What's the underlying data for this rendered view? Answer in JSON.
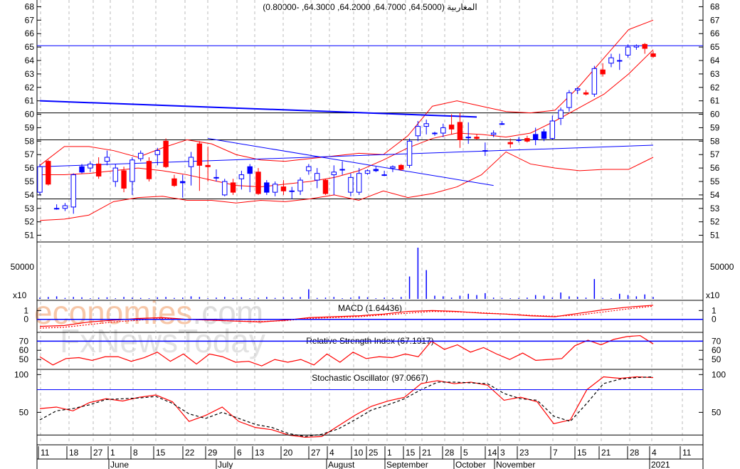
{
  "title": "المغاربية (64.5000, 64.7000, 64.2000, 64.3000, -0.80000)",
  "watermark": {
    "brand1": "economies",
    "brand2": ".com",
    "brand3": "FxNewsToday"
  },
  "colors": {
    "up": "#0000ff",
    "down": "#ff0000",
    "band": "#ff0000",
    "line": "#0000ff"
  },
  "chart_data": [
    {
      "type": "candlestick",
      "name": "price",
      "title": "المغاربية (64.5000, 64.7000, 64.2000, 64.3000, -0.80000)",
      "ylim": [
        50.5,
        68.5
      ],
      "yticks": [
        51,
        52,
        53,
        54,
        55,
        56,
        57,
        58,
        59,
        60,
        61,
        62,
        63,
        64,
        65,
        66,
        67,
        68
      ],
      "candles": [
        [
          54.2,
          56.3,
          54.0,
          56.1
        ],
        [
          56.5,
          56.6,
          54.7,
          54.8
        ],
        [
          53.0,
          53.3,
          52.9,
          53.0
        ],
        [
          53.0,
          53.4,
          52.8,
          53.2
        ],
        [
          53.1,
          55.6,
          52.6,
          55.5
        ],
        [
          56.1,
          56.3,
          55.6,
          55.7
        ],
        [
          56.0,
          56.5,
          55.7,
          56.3
        ],
        [
          56.3,
          56.8,
          55.2,
          55.4
        ],
        [
          56.5,
          57.3,
          56.2,
          56.8
        ],
        [
          55.0,
          56.3,
          54.6,
          56.0
        ],
        [
          55.8,
          56.1,
          54.2,
          54.5
        ],
        [
          55.0,
          56.8,
          54.0,
          56.6
        ],
        [
          56.7,
          57.3,
          56.5,
          57.1
        ],
        [
          56.5,
          56.8,
          55.0,
          55.2
        ],
        [
          57.0,
          57.5,
          56.2,
          57.3
        ],
        [
          58.0,
          58.2,
          56.0,
          56.1
        ],
        [
          55.2,
          55.5,
          54.6,
          54.7
        ],
        [
          55.0,
          55.5,
          53.8,
          54.9
        ],
        [
          56.1,
          57.2,
          54.7,
          56.8
        ],
        [
          57.8,
          58.0,
          54.3,
          56.2
        ],
        [
          56.2,
          57.6,
          55.0,
          56.1
        ],
        [
          55.3,
          55.9,
          55.0,
          55.3
        ],
        [
          54.0,
          55.2,
          53.9,
          55.0
        ],
        [
          54.9,
          55.2,
          54.0,
          54.2
        ],
        [
          55.2,
          55.8,
          54.4,
          55.5
        ],
        [
          56.1,
          56.3,
          54.2,
          55.6
        ],
        [
          55.7,
          56.0,
          54.0,
          54.1
        ],
        [
          54.9,
          55.1,
          54.0,
          54.2
        ],
        [
          54.2,
          55.0,
          53.9,
          54.8
        ],
        [
          54.6,
          55.1,
          54.0,
          54.3
        ],
        [
          54.3,
          54.6,
          53.7,
          54.3
        ],
        [
          54.3,
          55.3,
          54.0,
          55.1
        ],
        [
          55.8,
          56.3,
          55.5,
          56.1
        ],
        [
          55.1,
          56.0,
          54.5,
          55.6
        ],
        [
          55.1,
          55.2,
          54.0,
          54.1
        ],
        [
          55.5,
          56.2,
          54.0,
          55.7
        ],
        [
          55.9,
          56.5,
          55.5,
          55.9
        ],
        [
          54.2,
          55.6,
          53.9,
          55.3
        ],
        [
          54.2,
          56.0,
          54.0,
          55.6
        ],
        [
          55.6,
          55.9,
          55.5,
          55.8
        ],
        [
          55.9,
          56.1,
          55.7,
          55.8
        ],
        [
          55.5,
          55.8,
          55.4,
          55.5
        ],
        [
          56.0,
          56.2,
          55.7,
          56.1
        ],
        [
          56.2,
          56.3,
          55.8,
          55.9
        ],
        [
          56.2,
          58.2,
          56.0,
          58.0
        ],
        [
          58.4,
          59.5,
          58.0,
          59.1
        ],
        [
          59.1,
          59.6,
          58.5,
          59.3
        ],
        [
          58.6,
          58.7,
          58.4,
          58.6
        ],
        [
          58.6,
          59.3,
          58.3,
          59.0
        ],
        [
          59.2,
          60.0,
          58.5,
          58.9
        ],
        [
          59.4,
          60.1,
          57.5,
          58.1
        ],
        [
          58.3,
          59.4,
          57.8,
          58.3
        ],
        [
          58.3,
          58.5,
          58.1,
          58.2
        ],
        [
          57.3,
          57.9,
          56.9,
          57.3
        ],
        [
          58.5,
          58.8,
          58.3,
          58.6
        ],
        [
          59.3,
          59.5,
          59.2,
          59.3
        ],
        [
          57.9,
          58.2,
          57.5,
          57.8
        ],
        [
          58.1,
          58.3,
          57.9,
          58.1
        ],
        [
          58.2,
          58.4,
          57.9,
          58.0
        ],
        [
          58.5,
          59.0,
          57.7,
          58.1
        ],
        [
          58.7,
          58.9,
          58.0,
          58.2
        ],
        [
          58.2,
          59.9,
          58.1,
          59.5
        ],
        [
          59.7,
          60.5,
          59.2,
          60.3
        ],
        [
          60.5,
          61.8,
          60.2,
          61.6
        ],
        [
          61.8,
          62.0,
          61.5,
          61.9
        ],
        [
          61.6,
          61.8,
          61.4,
          61.5
        ],
        [
          61.5,
          63.6,
          61.3,
          63.4
        ],
        [
          63.3,
          63.8,
          62.8,
          63.0
        ],
        [
          63.8,
          64.5,
          63.5,
          64.2
        ],
        [
          64.0,
          64.5,
          63.3,
          64.0
        ],
        [
          64.4,
          65.2,
          64.2,
          65.0
        ],
        [
          65.0,
          65.2,
          64.8,
          65.1
        ],
        [
          65.2,
          65.3,
          64.5,
          64.9
        ],
        [
          64.5,
          64.7,
          64.2,
          64.3
        ]
      ],
      "bollinger_upper": [
        56.2,
        57.6,
        57.6,
        57.3,
        56.8,
        57.5,
        58.1,
        57.8,
        57.0,
        56.6,
        56.5,
        56.7,
        56.9,
        57.1,
        57.0,
        58.4,
        60.6,
        61.0,
        60.6,
        60.2,
        60.1,
        60.3,
        62.1,
        64.2,
        66.3,
        67.0
      ],
      "bollinger_middle": [
        55.5,
        55.5,
        55.6,
        55.8,
        56.0,
        55.8,
        55.5,
        55.1,
        54.7,
        54.6,
        54.8,
        55.0,
        55.3,
        55.8,
        56.6,
        57.5,
        58.2,
        58.6,
        58.5,
        58.3,
        58.6,
        59.5,
        60.5,
        61.5,
        63.0,
        64.8
      ],
      "bollinger_lower": [
        52.1,
        52.2,
        52.5,
        53.5,
        53.8,
        53.9,
        53.6,
        53.6,
        53.4,
        53.6,
        53.5,
        53.7,
        54.0,
        53.6,
        54.3,
        53.8,
        54.1,
        54.6,
        55.5,
        57.2,
        56.3,
        56.0,
        55.8,
        55.9,
        55.9,
        56.8
      ],
      "horizontal_lines": [
        65.1,
        60.1,
        58.1,
        53.7
      ],
      "trendlines": [
        [
          [
            0,
            61.0
          ],
          [
            52,
            59.8
          ]
        ],
        [
          [
            20,
            58.2
          ],
          [
            54,
            54.7
          ]
        ],
        [
          [
            0,
            56.1
          ],
          [
            73,
            57.7
          ]
        ]
      ]
    },
    {
      "type": "bar",
      "name": "volume",
      "ytick_label": "50000",
      "scale_label": "x10",
      "ylim": [
        0,
        80000
      ],
      "values": [
        2000,
        3000,
        4000,
        1500,
        3000,
        2500,
        1000,
        2000,
        2500,
        1000,
        3000,
        2000,
        1500,
        1000,
        2500,
        3000,
        1500,
        2000,
        4000,
        3000,
        1000,
        2000,
        3000,
        1500,
        2500,
        1000,
        2000,
        3000,
        1500,
        2500,
        2000,
        3000,
        15000,
        1500,
        2000,
        3000,
        1000,
        2000,
        4000,
        2500,
        1000,
        2000,
        1500,
        3000,
        35000,
        80000,
        45000,
        5000,
        4000,
        2000,
        5000,
        8000,
        6000,
        9000,
        2000,
        1500,
        1000,
        1500,
        2000,
        6000,
        5000,
        2000,
        10000,
        4000,
        3000,
        2000,
        31000,
        1500,
        1000,
        8000,
        6000,
        4000,
        7000,
        3000
      ]
    },
    {
      "type": "line",
      "name": "macd",
      "title": "MACD (1.64436)",
      "yticks": [
        1,
        0
      ],
      "ylim": [
        -1.4,
        2.0
      ],
      "macd": [
        -0.8,
        -0.7,
        -0.3,
        -0.1,
        0.1,
        0.2,
        0.0,
        -0.1,
        -0.2,
        -0.3,
        -0.1,
        0.2,
        0.3,
        0.4,
        0.6,
        0.9,
        1.0,
        0.9,
        0.7,
        0.6,
        0.4,
        0.3,
        0.7,
        1.1,
        1.4,
        1.6
      ],
      "signal": [
        -1.0,
        -0.9,
        -0.6,
        -0.3,
        -0.1,
        0.1,
        0.0,
        -0.1,
        -0.2,
        -0.25,
        -0.15,
        0.1,
        0.2,
        0.3,
        0.5,
        0.7,
        0.9,
        0.85,
        0.75,
        0.6,
        0.45,
        0.35,
        0.5,
        0.85,
        1.2,
        1.5
      ]
    },
    {
      "type": "line",
      "name": "rsi",
      "title": "Relative Strength Index (67.1917)",
      "yticks": [
        70,
        60,
        50
      ],
      "ylim": [
        40,
        78
      ],
      "reference": 70,
      "values": [
        53,
        44,
        51,
        52,
        49,
        53,
        53,
        48,
        52,
        58,
        48,
        56,
        45,
        56,
        53,
        47,
        48,
        43,
        50,
        47,
        50,
        44,
        56,
        47,
        58,
        51,
        53,
        52,
        56,
        53,
        70,
        61,
        66,
        58,
        63,
        56,
        50,
        57,
        49,
        50,
        51,
        65,
        71,
        66,
        72,
        75,
        76,
        67
      ]
    },
    {
      "type": "line",
      "name": "stochastic",
      "title": "Stochastic Oscillator (97.0667)",
      "yticks": [
        100,
        50
      ],
      "ylim": [
        8,
        105
      ],
      "reference": [
        80,
        20
      ],
      "k": [
        55,
        57,
        52,
        63,
        68,
        65,
        70,
        73,
        64,
        38,
        46,
        57,
        38,
        30,
        27,
        20,
        17,
        18,
        32,
        46,
        58,
        65,
        70,
        88,
        92,
        88,
        90,
        86,
        66,
        70,
        64,
        35,
        40,
        80,
        97,
        95,
        97,
        96
      ],
      "d": [
        40,
        52,
        55,
        60,
        67,
        68,
        69,
        71,
        62,
        48,
        42,
        50,
        42,
        34,
        30,
        22,
        18,
        21,
        28,
        40,
        53,
        60,
        68,
        80,
        90,
        90,
        89,
        88,
        75,
        68,
        66,
        45,
        38,
        62,
        88,
        94,
        96,
        97
      ]
    }
  ],
  "x_axis": {
    "days": [
      "11",
      "18",
      "27",
      "1",
      "8",
      "15",
      "22",
      "29",
      "6",
      "13",
      "20",
      "27",
      "4",
      "10",
      "25",
      "1",
      "15",
      "21",
      "28",
      "5",
      "14",
      "3",
      "23",
      "7",
      "15",
      "21",
      "28",
      "4",
      "11"
    ],
    "months": [
      "June",
      "July",
      "August",
      "September",
      "October",
      "November",
      "2021"
    ]
  }
}
